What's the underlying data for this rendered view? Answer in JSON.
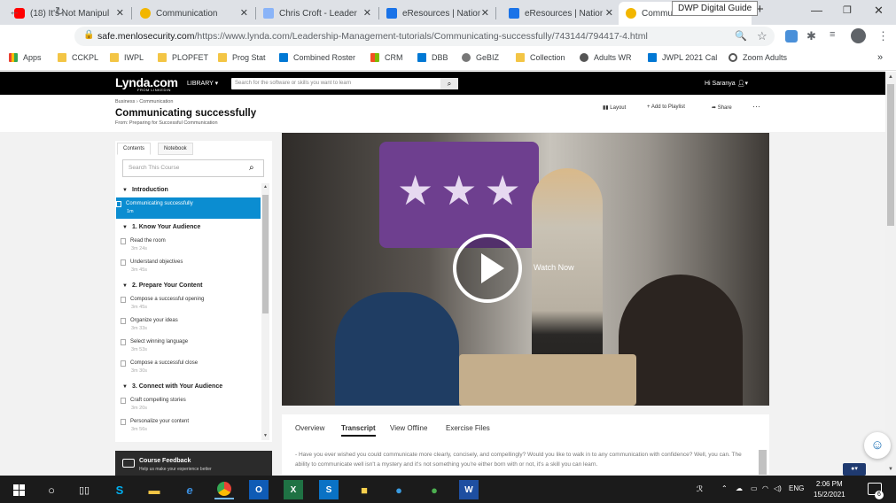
{
  "browser": {
    "tabs": [
      {
        "title": "(18) It's Not Manipul",
        "icon_color": "#ff0000"
      },
      {
        "title": "Communication",
        "icon_color": "#f2b600"
      },
      {
        "title": "Chris Croft - Leaders",
        "icon_color": "#8ab4f8"
      },
      {
        "title": "eResources | Nationa",
        "icon_color": "#1a73e8"
      },
      {
        "title": "eResources | Nationa",
        "icon_color": "#1a73e8"
      },
      {
        "title": "Commu",
        "icon_color": "#f2b600"
      }
    ],
    "tooltip": "DWP Digital Guide",
    "url_host": "safe.menlosecurity.com",
    "url_rest": "/https://www.lynda.com/Leadership-Management-tutorials/Communicating-successfully/743144/794417-4.html",
    "bookmarks": [
      "Apps",
      "CCKPL",
      "IWPL",
      "PLOPFET",
      "Prog Stat",
      "Combined Roster",
      "CRM",
      "DBB",
      "GeBIZ",
      "Collection",
      "Adults WR",
      "JWPL 2021 Cal",
      "Zoom Adults"
    ]
  },
  "site": {
    "logo": "Lynda.com",
    "logo_sub": "FROM LINKEDIN",
    "library": "LIBRARY",
    "search_placeholder": "Search for the software or skills you want to learn",
    "greeting": "Hi Saranya"
  },
  "course": {
    "breadcrumb": "Business  ›  Communication",
    "title": "Communicating successfully",
    "from": "From: Preparing for Successful Communication",
    "actions": {
      "layout": "Layout",
      "playlist": "Add to Playlist",
      "share": "Share"
    }
  },
  "sidebar": {
    "tabs": [
      "Contents",
      "Notebook"
    ],
    "search_placeholder": "Search This Course",
    "sections": [
      {
        "title": "Introduction",
        "items": [
          {
            "title": "Communicating successfully",
            "duration": "1m"
          }
        ]
      },
      {
        "title": "1. Know Your Audience",
        "items": [
          {
            "title": "Read the room",
            "duration": "3m 24s"
          },
          {
            "title": "Understand objectives",
            "duration": "3m 45s"
          }
        ]
      },
      {
        "title": "2. Prepare Your Content",
        "items": [
          {
            "title": "Compose a successful opening",
            "duration": "3m 45s"
          },
          {
            "title": "Organize your ideas",
            "duration": "3m 33s"
          },
          {
            "title": "Select winning language",
            "duration": "3m 53s"
          },
          {
            "title": "Compose a successful close",
            "duration": "3m 30s"
          }
        ]
      },
      {
        "title": "3. Connect with Your Audience",
        "items": [
          {
            "title": "Craft compelling stories",
            "duration": "3m 20s"
          },
          {
            "title": "Personalize your content",
            "duration": "3m 56s"
          }
        ]
      }
    ],
    "feedback_title": "Course Feedback",
    "feedback_sub": "Help us make your experience better"
  },
  "video": {
    "watch_label": "Watch Now"
  },
  "content_tabs": [
    "Overview",
    "Transcript",
    "View Offline",
    "Exercise Files"
  ],
  "transcript": "- Have you ever wished you could communicate more clearly, concisely, and compellingly? Would you like to walk in to any communication with confidence? Well, you can. The ability to communicate well isn't a mystery and it's not something you're either born with or not, it's a skill you can learn.",
  "taskbar": {
    "time": "2:06 PM",
    "date": "15/2/2021",
    "lang": "ENG",
    "notif": "6"
  }
}
